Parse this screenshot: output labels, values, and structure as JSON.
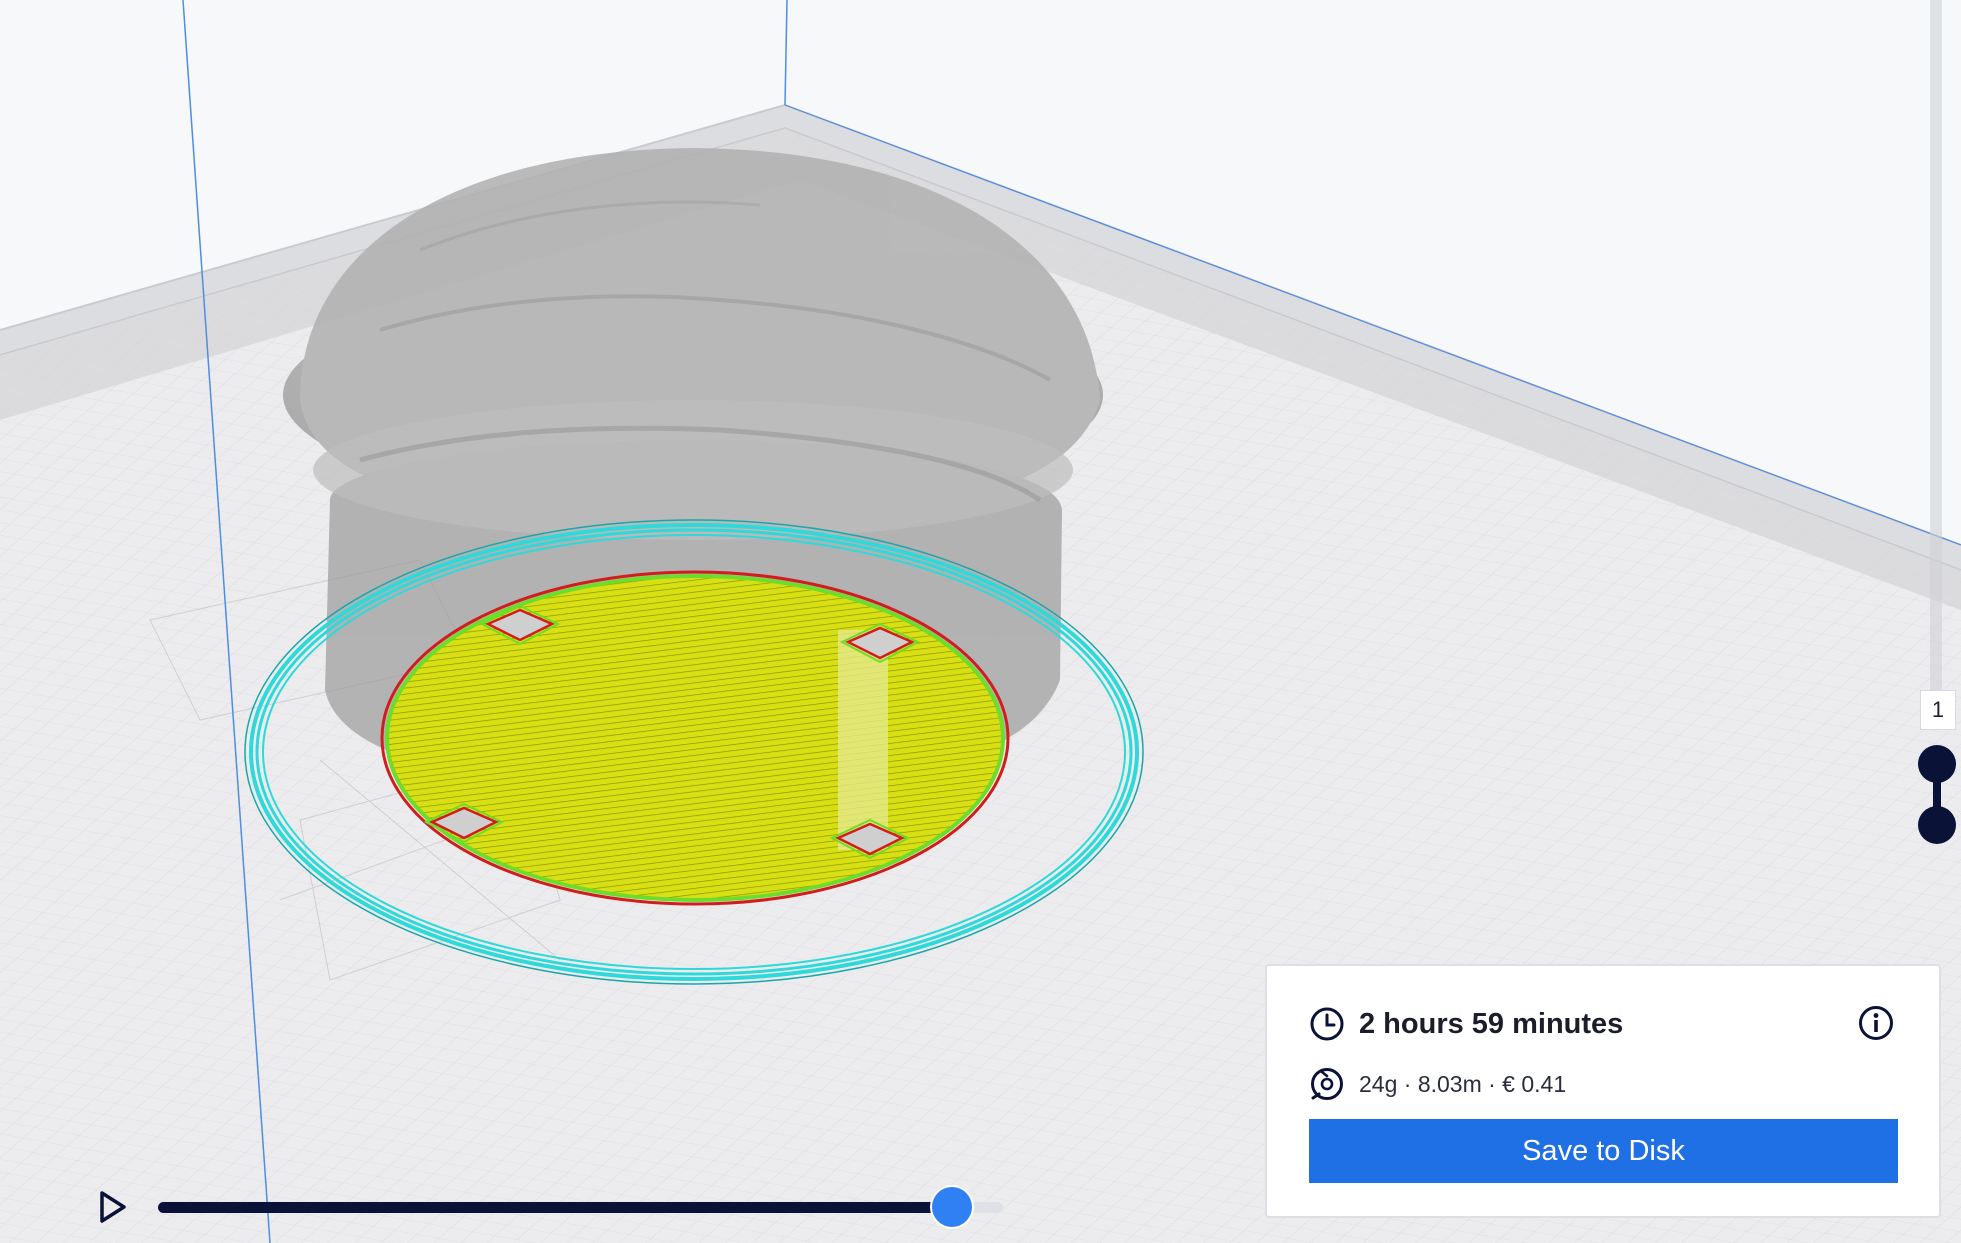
{
  "viewport": {
    "scene": "3D build plate with sliced model in layer view",
    "colors": {
      "background": "#f7f8fa",
      "plate": "#ececee",
      "plate_grid": "#d6d8dc",
      "model_ghost": "#a8a8a8",
      "skirt": "#2fd9d9",
      "infill": "#d8e014",
      "outer_wall": "#d21d1d",
      "inner_wall": "#6ddc2a",
      "axis_line": "#4f8de0"
    }
  },
  "layer_slider": {
    "current_layer": "1",
    "handle_color": "#0b1238"
  },
  "simulation": {
    "progress_fraction": 0.94,
    "play_icon": "play-icon",
    "track_color": "#dfe1e6",
    "fill_color": "#0b1238",
    "handle_color": "#2f80f2"
  },
  "print_panel": {
    "time_icon": "clock-icon",
    "print_time": "2 hours 59 minutes",
    "info_icon": "info-icon",
    "material_icon": "spool-icon",
    "material_summary": "24g · 8.03m · € 0.41",
    "save_label": "Save to Disk",
    "accent_color": "#1f6fe5"
  }
}
